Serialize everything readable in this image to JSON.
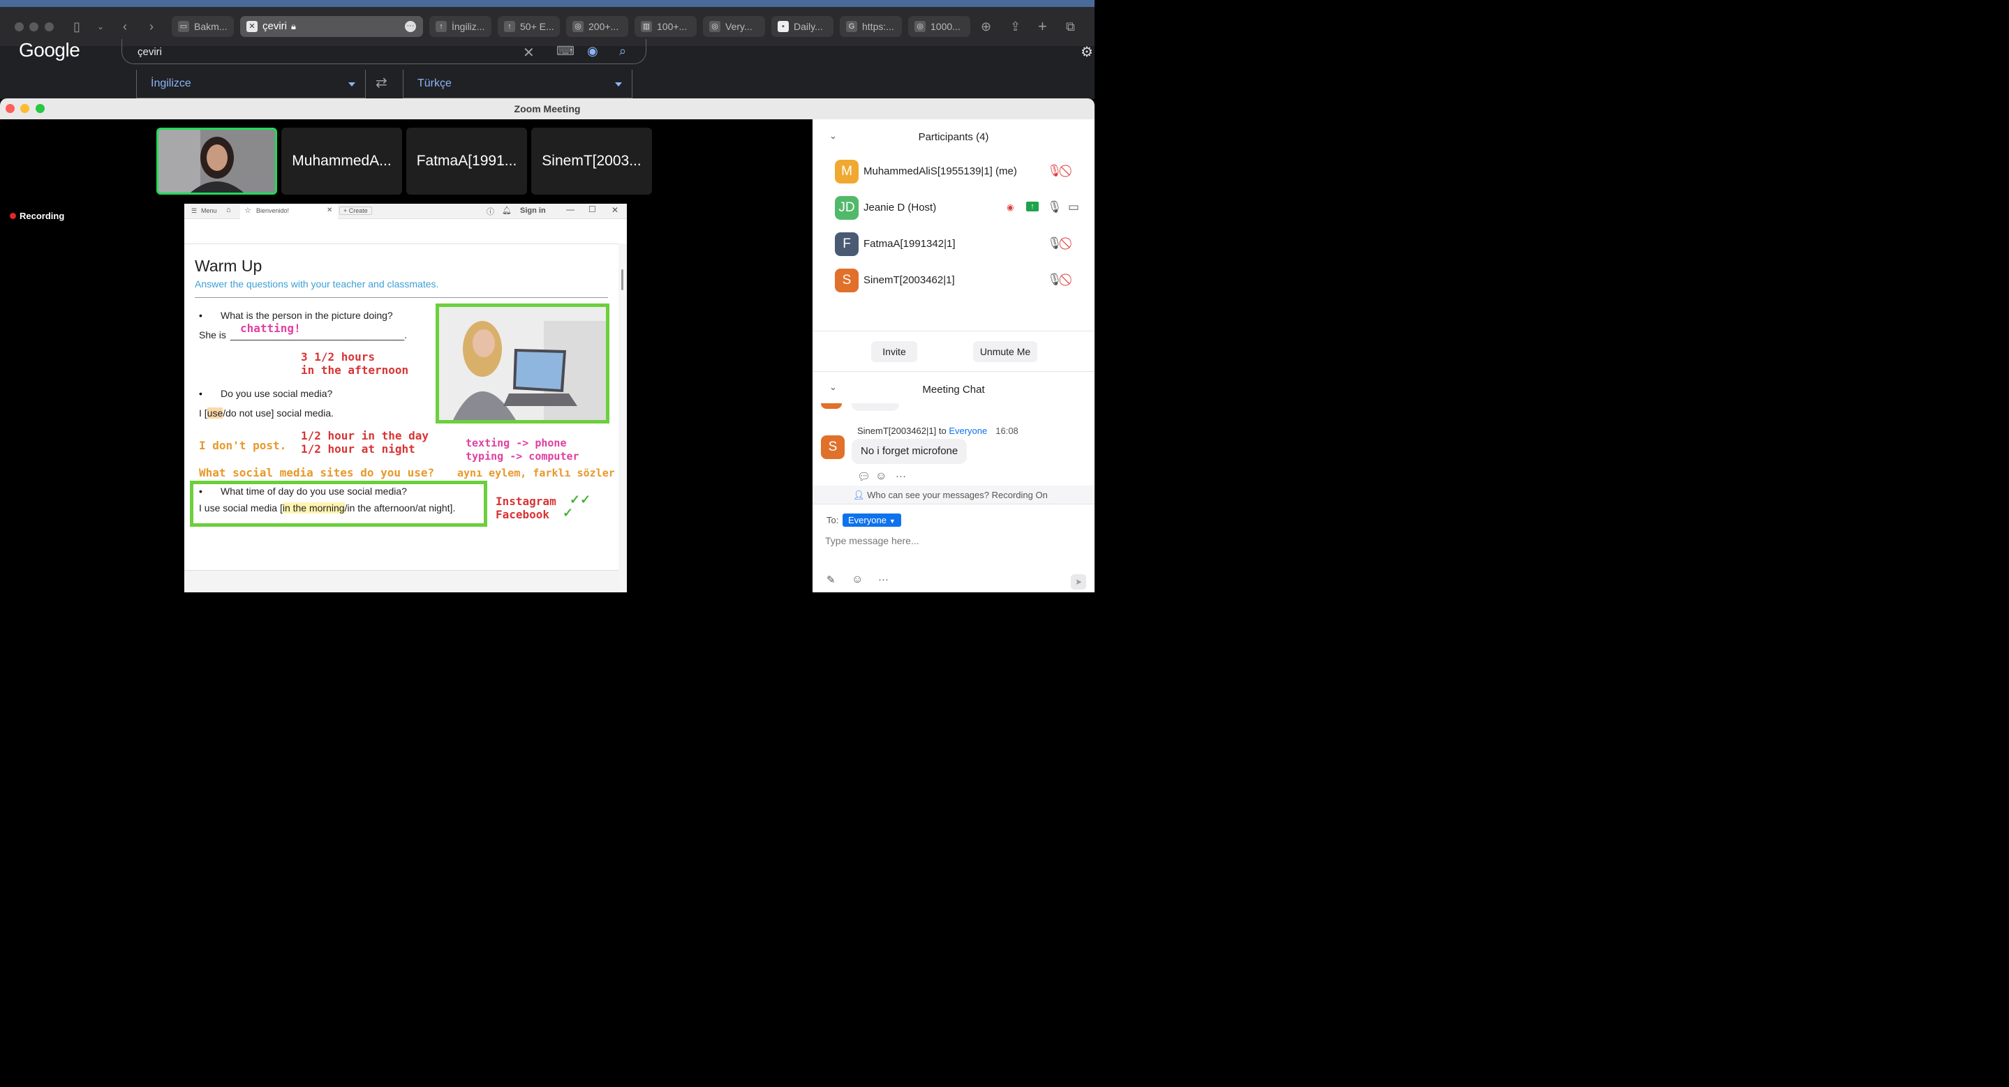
{
  "browser": {
    "tabs": [
      {
        "label": "Bakm...",
        "icon": "tv-icon"
      },
      {
        "label": "çeviri",
        "icon": "x-icon",
        "active": true
      },
      {
        "label": "İngiliz...",
        "icon": "pin-icon"
      },
      {
        "label": "50+ E...",
        "icon": "pin-icon"
      },
      {
        "label": "200+...",
        "icon": "globe-icon"
      },
      {
        "label": "100+...",
        "icon": "book-icon"
      },
      {
        "label": "Very...",
        "icon": "globe-icon"
      },
      {
        "label": "Daily...",
        "icon": "site-icon"
      },
      {
        "label": "https:...",
        "icon": "g-icon"
      },
      {
        "label": "1000...",
        "icon": "globe-icon"
      }
    ]
  },
  "google": {
    "logo": "Google",
    "search_value": "çeviri",
    "source_lang": "İngilizce",
    "target_lang": "Türkçe"
  },
  "zoom": {
    "window_title": "Zoom Meeting",
    "recording_label": "Recording",
    "thumbnails": [
      "MuhammedA...",
      "FatmaA[1991...",
      "SinemT[2003..."
    ],
    "shared_screen": {
      "browser_menu": "Menu",
      "browser_tab": "Bienvenido!",
      "create_tab": "Create",
      "sign_in": "Sign in",
      "title": "Warm Up",
      "subtitle": "Answer the questions with your teacher and classmates.",
      "q1": "What is the person in the picture doing?",
      "q1_answer_prefix": "She is",
      "q1_blank": "________________________________.",
      "note_chatting": "chatting!",
      "note_hours_1": "3 1/2 hours",
      "note_hours_2": "in the afternoon",
      "q2": "Do you use social media?",
      "q2_answer_pre": "I [",
      "q2_answer_use": "use",
      "q2_answer_post": "/do not use] social media.",
      "note_dont_post": "I don't post.",
      "note_day": "1/2 hour in the day",
      "note_night": "1/2 hour at night",
      "note_texting": "texting -> phone",
      "note_typing": "typing -> computer",
      "note_same": "aynı eylem, farklı sözler",
      "note_sites": "What social media sites do you use?",
      "q3": "What time of day do you use social media?",
      "q3_answer_pre": "I use social media [",
      "q3_answer_morning": "in the morning",
      "q3_answer_post": "/in the afternoon/at night].",
      "note_instagram": "Instagram",
      "note_facebook": "Facebook",
      "check_double": "✓✓",
      "check_single": "✓",
      "bullet": "•"
    },
    "participants": {
      "header": "Participants (4)",
      "list": [
        {
          "initials": "M",
          "name": "MuhammedAliS[1955139|1] (me)",
          "color": "#f0a830"
        },
        {
          "initials": "JD",
          "name": "Jeanie D (Host)",
          "color": "#52b96a"
        },
        {
          "initials": "F",
          "name": "FatmaA[1991342|1]",
          "color": "#4a5a72"
        },
        {
          "initials": "S",
          "name": "SinemT[2003462|1]",
          "color": "#e0702a"
        }
      ],
      "invite_label": "Invite",
      "unmute_label": "Unmute Me"
    },
    "chat": {
      "header": "Meeting Chat",
      "sender": "SinemT[2003462|1]",
      "to_word": "to",
      "recipient": "Everyone",
      "time": "16:08",
      "message": "No i forget microfone",
      "sender_initial": "S",
      "visibility_note": "Who can see your messages? Recording On",
      "to_label": "To:",
      "to_value": "Everyone",
      "placeholder": "Type message here..."
    }
  }
}
